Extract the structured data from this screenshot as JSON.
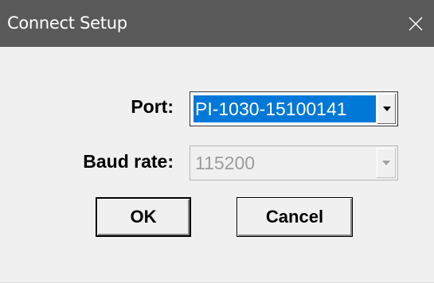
{
  "window": {
    "title": "Connect Setup",
    "close_icon": "close-icon"
  },
  "form": {
    "port": {
      "label": "Port:",
      "value": "PI-1030-15100141",
      "selected": true,
      "dropdown_icon": "chevron-down-icon"
    },
    "baud": {
      "label": "Baud rate:",
      "value": "115200",
      "disabled": true,
      "dropdown_icon": "chevron-down-icon"
    }
  },
  "buttons": {
    "ok_label": "OK",
    "cancel_label": "Cancel"
  },
  "colors": {
    "titlebar": "#595959",
    "selection": "#0078d7",
    "dialog_bg": "#f0f0f0",
    "disabled_text": "#9c9c9c"
  }
}
